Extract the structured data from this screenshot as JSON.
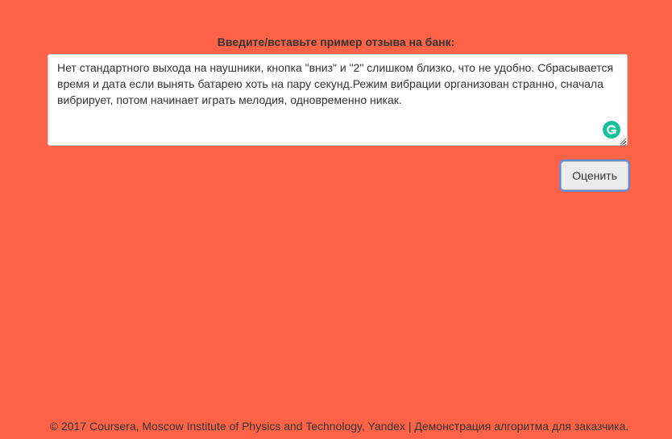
{
  "form": {
    "label": "Введите/вставьте пример отзыва на банк:",
    "review_text": "Нет стандартного выхода на наушники, кнопка \"вниз\" и \"2\" слишком близко, что не удобно. Сбрасывается время и дата если вынять батарею хоть на пару секунд.Режим вибрации организован странно, сначала вибрирует, потом начинает играть мелодия, одновременно никак.",
    "submit_label": "Оценить"
  },
  "icons": {
    "grammarly": "grammarly-icon",
    "resize": "resize-handle-icon"
  },
  "colors": {
    "background": "#ff6347",
    "grammarly": "#15c39a",
    "button_focus": "#5b8ede"
  },
  "footer": {
    "text": "© 2017 Coursera, Moscow Institute of Physics and Technology, Yandex | Демонстрация алгоритма для заказчика."
  }
}
